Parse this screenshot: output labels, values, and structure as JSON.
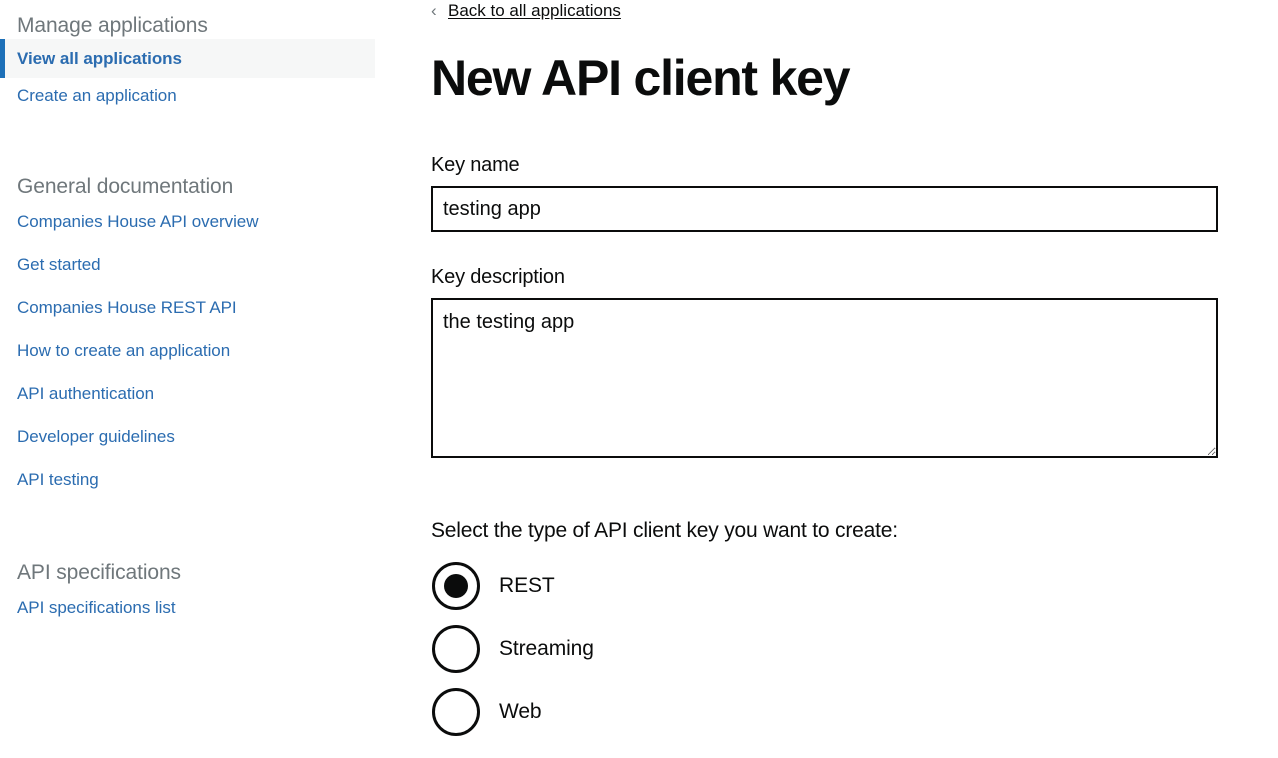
{
  "sidebar": {
    "manage": {
      "heading": "Manage applications",
      "items": [
        {
          "label": "View all applications",
          "active": true
        },
        {
          "label": "Create an application",
          "active": false
        }
      ]
    },
    "general_documentation": {
      "heading": "General documentation",
      "items": [
        {
          "label": "Companies House API overview"
        },
        {
          "label": "Get started"
        },
        {
          "label": "Companies House REST API"
        },
        {
          "label": "How to create an application"
        },
        {
          "label": "API authentication"
        },
        {
          "label": "Developer guidelines"
        },
        {
          "label": "API testing"
        }
      ]
    },
    "api_specifications": {
      "heading": "API specifications",
      "items": [
        {
          "label": "API specifications list"
        }
      ]
    }
  },
  "main": {
    "back_link": {
      "chevron": "‹",
      "label": "Back to all applications"
    },
    "title": "New API client key",
    "fields": {
      "key_name": {
        "label": "Key name",
        "value": "testing app",
        "placeholder": ""
      },
      "key_description": {
        "label": "Key description",
        "value": "the testing app",
        "placeholder": ""
      }
    },
    "key_type": {
      "intro": "Select the type of API client key you want to create:",
      "options": [
        {
          "label": "REST",
          "checked": true
        },
        {
          "label": "Streaming",
          "checked": false
        },
        {
          "label": "Web",
          "checked": false
        }
      ]
    }
  },
  "colors": {
    "link_blue": "#2b6cb0",
    "active_bar": "#1d70b8",
    "active_bg": "#f6f7f7",
    "heading_gray": "#6f777b",
    "text_black": "#0b0c0c",
    "border_black": "#0b0c0c",
    "page_bg": "#ffffff"
  }
}
